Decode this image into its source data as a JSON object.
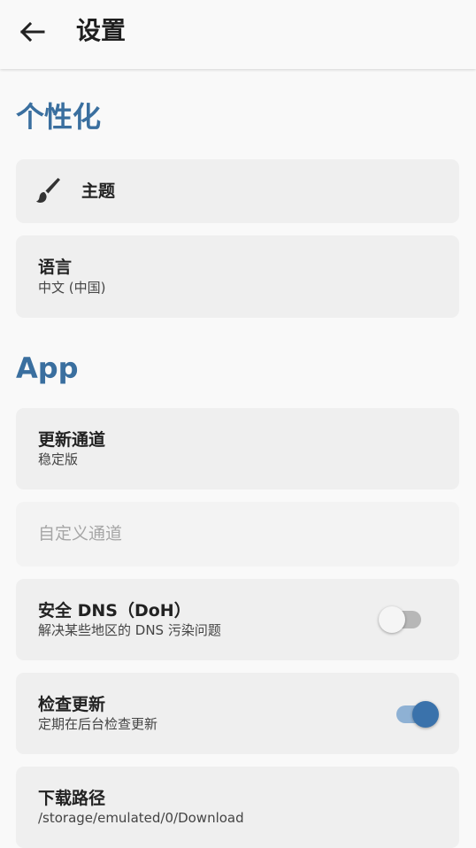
{
  "header": {
    "title": "设置",
    "back_icon": "arrow-left-icon"
  },
  "sections": {
    "personalization": {
      "title": "个性化"
    },
    "app": {
      "title": "App"
    }
  },
  "items": {
    "theme": {
      "title": "主题",
      "icon": "paint-brush-icon"
    },
    "language": {
      "title": "语言",
      "subtitle": "中文 (中国)"
    },
    "update_channel": {
      "title": "更新通道",
      "subtitle": "稳定版"
    },
    "custom_channel": {
      "title": "自定义通道",
      "enabled": false
    },
    "secure_dns": {
      "title": "安全 DNS（DoH）",
      "subtitle": "解决某些地区的 DNS 污染问题",
      "toggle": false
    },
    "check_updates": {
      "title": "检查更新",
      "subtitle": "定期在后台检查更新",
      "toggle": true
    },
    "download_path": {
      "title": "下载路径",
      "subtitle": "/storage/emulated/0/Download"
    }
  },
  "colors": {
    "accent": "#3a72ab",
    "section_header": "#3a6f9f",
    "card_background": "#efefef",
    "page_background": "#f9f9f9"
  }
}
